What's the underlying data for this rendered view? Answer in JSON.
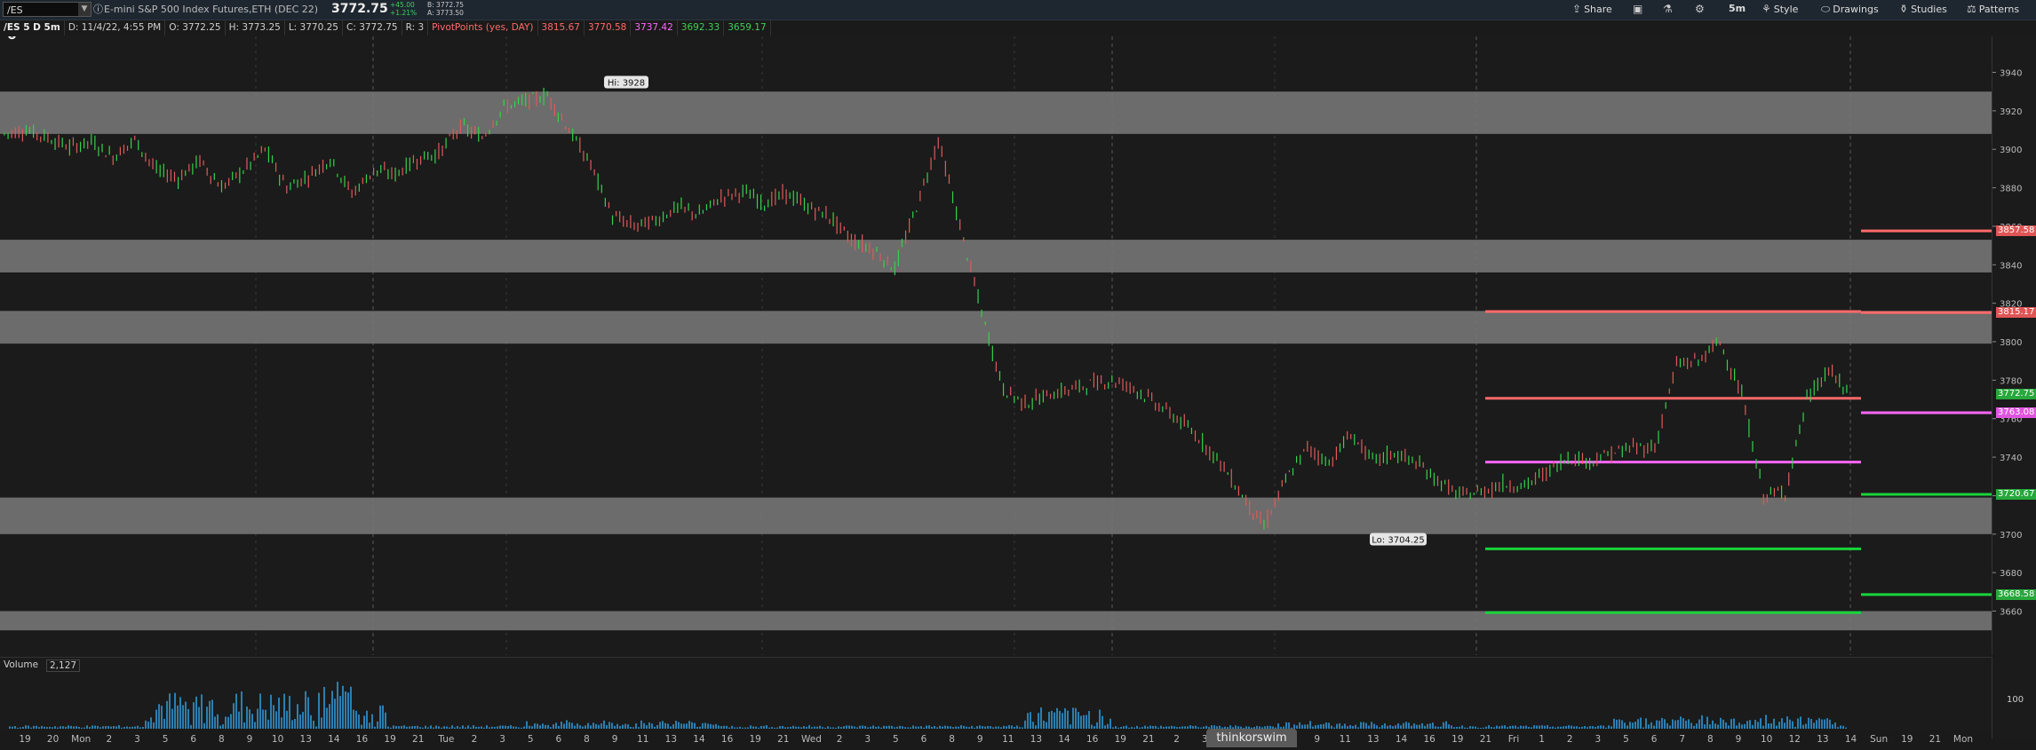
{
  "toolbar": {
    "symbol": "/ES",
    "description": "E-mini S&P 500 Index Futures,ETH (DEC 22)",
    "last_price": "3772.75",
    "change_abs": "+45.00",
    "change_pct": "+1.21%",
    "bid": "B: 3772.75",
    "ask": "A: 3773.50",
    "share_label": "Share",
    "timeframe_label": "5m",
    "style_label": "Style",
    "drawings_label": "Drawings",
    "studies_label": "Studies",
    "patterns_label": "Patterns"
  },
  "infobar": {
    "chart_id": "/ES 5 D 5m",
    "date": "D: 11/4/22, 4:55 PM",
    "open": "O: 3772.25",
    "high": "H: 3773.25",
    "low": "L: 3770.25",
    "close": "C: 3772.75",
    "range": "R: 3",
    "pivot_label": "PivotPoints (yes, DAY)",
    "pivot_values": [
      {
        "value": "3815.67",
        "color": "#ff6a6a"
      },
      {
        "value": "3770.58",
        "color": "#ff6a6a"
      },
      {
        "value": "3737.42",
        "color": "#ff66ff"
      },
      {
        "value": "3692.33",
        "color": "#3ecf5a"
      },
      {
        "value": "3659.17",
        "color": "#3ecf5a"
      }
    ]
  },
  "chart_data": {
    "type": "candlestick",
    "y_ticks": [
      "3940",
      "3920",
      "3900",
      "3880",
      "3860",
      "3840",
      "3820",
      "3800",
      "3780",
      "3760",
      "3740",
      "3720",
      "3700",
      "3680",
      "3660"
    ],
    "ylim": [
      3645,
      3955
    ],
    "zones": [
      [
        3908,
        3930
      ],
      [
        3836,
        3853
      ],
      [
        3799,
        3816
      ],
      [
        3700,
        3719
      ],
      [
        3650,
        3660
      ]
    ],
    "pivots_prev": [
      {
        "value": 3815.67,
        "color": "#ff6a6a"
      },
      {
        "value": 3770.58,
        "color": "#ff6a6a"
      },
      {
        "value": 3737.42,
        "color": "#ff66ff"
      },
      {
        "value": 3692.33,
        "color": "#19d43a"
      },
      {
        "value": 3659.17,
        "color": "#19d43a"
      }
    ],
    "pivots_next": [
      {
        "value": 3857.58,
        "color": "#ff6a6a"
      },
      {
        "value": 3815.17,
        "color": "#ff6a6a"
      },
      {
        "value": 3763.08,
        "color": "#ff66ff"
      },
      {
        "value": 3720.67,
        "color": "#19d43a"
      },
      {
        "value": 3668.58,
        "color": "#19d43a"
      }
    ],
    "price_tags": [
      {
        "text": "3857.58",
        "value": 3857.58,
        "color": "#e05555"
      },
      {
        "text": "3815.17",
        "value": 3815.17,
        "color": "#e05555"
      },
      {
        "text": "3772.75",
        "value": 3772.75,
        "color": "#27a83c"
      },
      {
        "text": "3763.08",
        "value": 3763.08,
        "color": "#e055e0"
      },
      {
        "text": "3720.67",
        "value": 3720.67,
        "color": "#27a83c"
      },
      {
        "text": "3668.58",
        "value": 3668.58,
        "color": "#27a83c"
      }
    ],
    "price_path": [
      3908,
      3910,
      3906,
      3901,
      3904,
      3896,
      3905,
      3889,
      3885,
      3894,
      3880,
      3889,
      3900,
      3880,
      3886,
      3895,
      3877,
      3889,
      3887,
      3895,
      3898,
      3912,
      3906,
      3922,
      3925,
      3928,
      3910,
      3892,
      3865,
      3860,
      3863,
      3870,
      3866,
      3875,
      3878,
      3872,
      3877,
      3870,
      3865,
      3853,
      3848,
      3838,
      3870,
      3905,
      3860,
      3815,
      3775,
      3768,
      3772,
      3775,
      3778,
      3780,
      3776,
      3768,
      3760,
      3750,
      3737,
      3720,
      3704,
      3728,
      3745,
      3737,
      3752,
      3738,
      3742,
      3737,
      3728,
      3720,
      3722,
      3726,
      3725,
      3732,
      3740,
      3738,
      3742,
      3745,
      3745,
      3788,
      3790,
      3800,
      3772,
      3720,
      3722,
      3770,
      3785,
      3772
    ],
    "path_x_start": 5,
    "path_x_end": 2083,
    "hi_label": "Hi: 3928",
    "lo_label": "Lo: 3704.25",
    "x_ticks": [
      "19",
      "20",
      "Mon",
      "2",
      "3",
      "5",
      "6",
      "8",
      "9",
      "10",
      "13",
      "14",
      "16",
      "19",
      "21",
      "Tue",
      "2",
      "3",
      "5",
      "6",
      "8",
      "9",
      "11",
      "13",
      "14",
      "16",
      "19",
      "21",
      "Wed",
      "2",
      "3",
      "5",
      "6",
      "8",
      "9",
      "11",
      "13",
      "14",
      "16",
      "19",
      "21",
      "2",
      "3",
      "5",
      "6",
      "8",
      "9",
      "11",
      "13",
      "14",
      "16",
      "19",
      "21",
      "Fri",
      "1",
      "2",
      "3",
      "5",
      "6",
      "7",
      "8",
      "9",
      "10",
      "12",
      "13",
      "14",
      "Sun",
      "19",
      "21",
      "Mon"
    ],
    "volume_label": "Volume",
    "volume_value": "2,127",
    "volume_tick": "100"
  },
  "watermark": "thinkorswim"
}
